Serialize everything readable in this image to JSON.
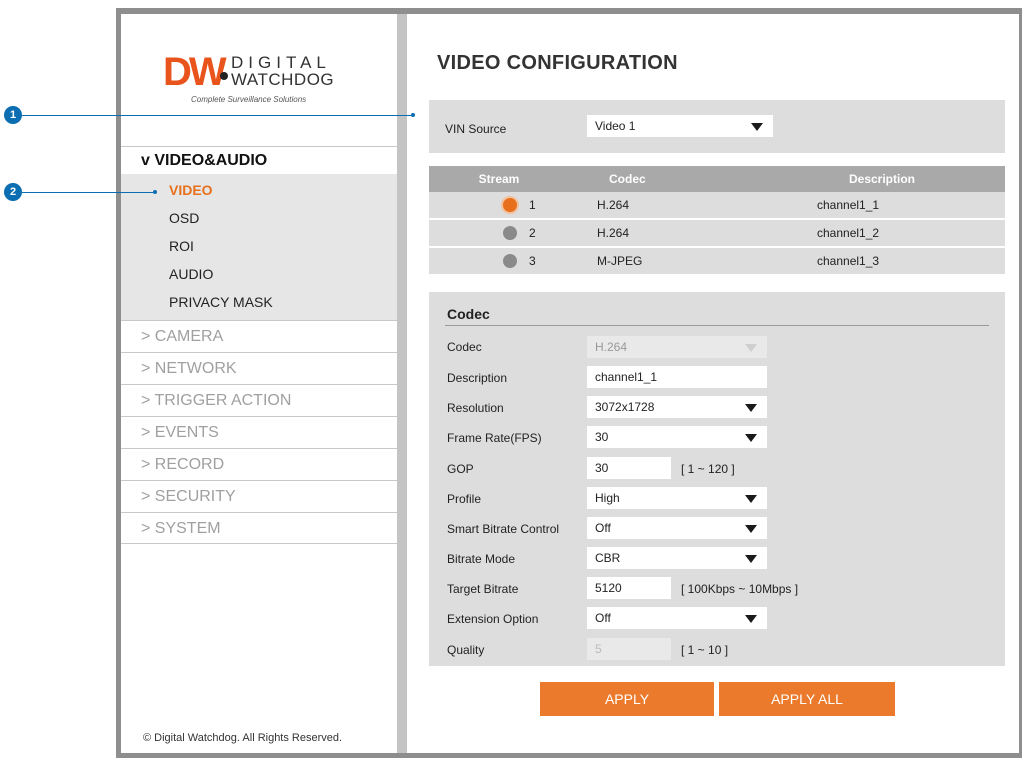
{
  "logo": {
    "mark": "DW",
    "line1": "DIGITAL",
    "line2": "WATCHDOG",
    "tagline": "Complete Surveillance Solutions"
  },
  "sidebar": {
    "section_open": "v VIDEO&AUDIO",
    "sub_items": [
      "VIDEO",
      "OSD",
      "ROI",
      "AUDIO",
      "PRIVACY MASK"
    ],
    "items": [
      "> CAMERA",
      "> NETWORK",
      "> TRIGGER ACTION",
      "> EVENTS",
      "> RECORD",
      "> SECURITY",
      "> SYSTEM"
    ],
    "copyright": "© Digital Watchdog. All Rights Reserved."
  },
  "main": {
    "title": "VIDEO CONFIGURATION",
    "vin": {
      "label": "VIN Source",
      "value": "Video 1"
    },
    "streams": {
      "headers": [
        "Stream",
        "Codec",
        "Description"
      ],
      "rows": [
        {
          "num": "1",
          "codec": "H.264",
          "desc": "channel1_1",
          "selected": true
        },
        {
          "num": "2",
          "codec": "H.264",
          "desc": "channel1_2",
          "selected": false
        },
        {
          "num": "3",
          "codec": "M-JPEG",
          "desc": "channel1_3",
          "selected": false
        }
      ]
    },
    "codec": {
      "title": "Codec",
      "codec": {
        "label": "Codec",
        "value": "H.264"
      },
      "description": {
        "label": "Description",
        "value": "channel1_1"
      },
      "resolution": {
        "label": "Resolution",
        "value": "3072x1728"
      },
      "frame_rate": {
        "label": "Frame Rate(FPS)",
        "value": "30"
      },
      "gop": {
        "label": "GOP",
        "value": "30",
        "hint": "[ 1 ~ 120 ]"
      },
      "profile": {
        "label": "Profile",
        "value": "High"
      },
      "smart_bitrate": {
        "label": "Smart Bitrate Control",
        "value": "Off"
      },
      "bitrate_mode": {
        "label": "Bitrate Mode",
        "value": "CBR"
      },
      "target_bitrate": {
        "label": "Target Bitrate",
        "value": "5120",
        "hint": "[ 100Kbps ~ 10Mbps ]"
      },
      "extension": {
        "label": "Extension Option",
        "value": "Off"
      },
      "quality": {
        "label": "Quality",
        "value": "5",
        "hint": "[ 1 ~ 10 ]"
      }
    },
    "buttons": {
      "apply": "APPLY",
      "apply_all": "APPLY ALL"
    }
  },
  "callouts": [
    "1",
    "2"
  ],
  "colors": {
    "accent": "#ec7a2c",
    "callout": "#0b6eb2",
    "panel": "#dddddd"
  }
}
